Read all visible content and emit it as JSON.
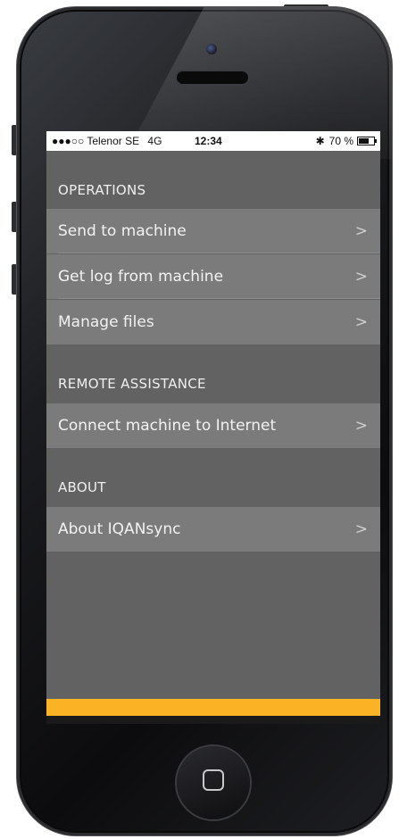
{
  "status_bar": {
    "signal": "●●●○○",
    "carrier": "Telenor SE",
    "network": "4G",
    "time": "12:34",
    "bluetooth": "✱",
    "battery_percent": "70 %",
    "battery_level": 0.7
  },
  "sections": {
    "operations": {
      "title": "OPERATIONS",
      "items": [
        {
          "label": "Send to machine"
        },
        {
          "label": "Get log from machine"
        },
        {
          "label": "Manage files"
        }
      ]
    },
    "remote": {
      "title": "REMOTE ASSISTANCE",
      "items": [
        {
          "label": "Connect machine to Internet"
        }
      ]
    },
    "about": {
      "title": "ABOUT",
      "items": [
        {
          "label": "About IQANsync"
        }
      ]
    }
  },
  "chevron": ">",
  "colors": {
    "screen_bg": "#626262",
    "row_bg": "#7b7b7b",
    "accent": "#fbb225"
  }
}
